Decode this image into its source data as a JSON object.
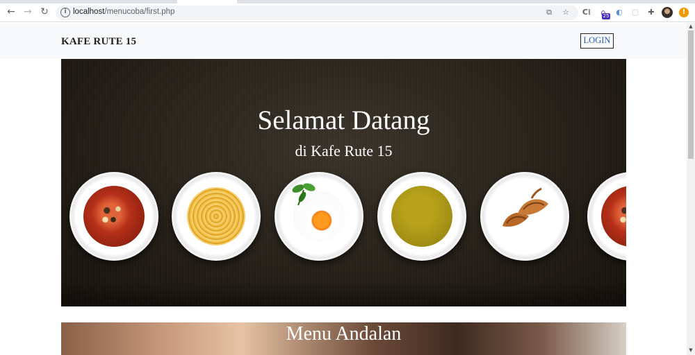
{
  "browser": {
    "url_host": "localhost",
    "url_path": "/menucoba/first.php",
    "profile_badge": "25",
    "update_icon": "!",
    "extension_icon_text": "C⁞"
  },
  "navbar": {
    "brand": "KAFE RUTE 15",
    "login_label": "LOGIN"
  },
  "hero": {
    "title": "Selamat Datang",
    "subtitle": "di Kafe Rute 15",
    "plates": [
      "soup-red",
      "pasta",
      "egg",
      "curry",
      "croissant",
      "soup-red"
    ]
  },
  "featured": {
    "title": "Menu Andalan"
  },
  "colors": {
    "link": "#2a5db0",
    "navbar_bg": "#f8f9fa",
    "hero_bg": "#262119"
  }
}
